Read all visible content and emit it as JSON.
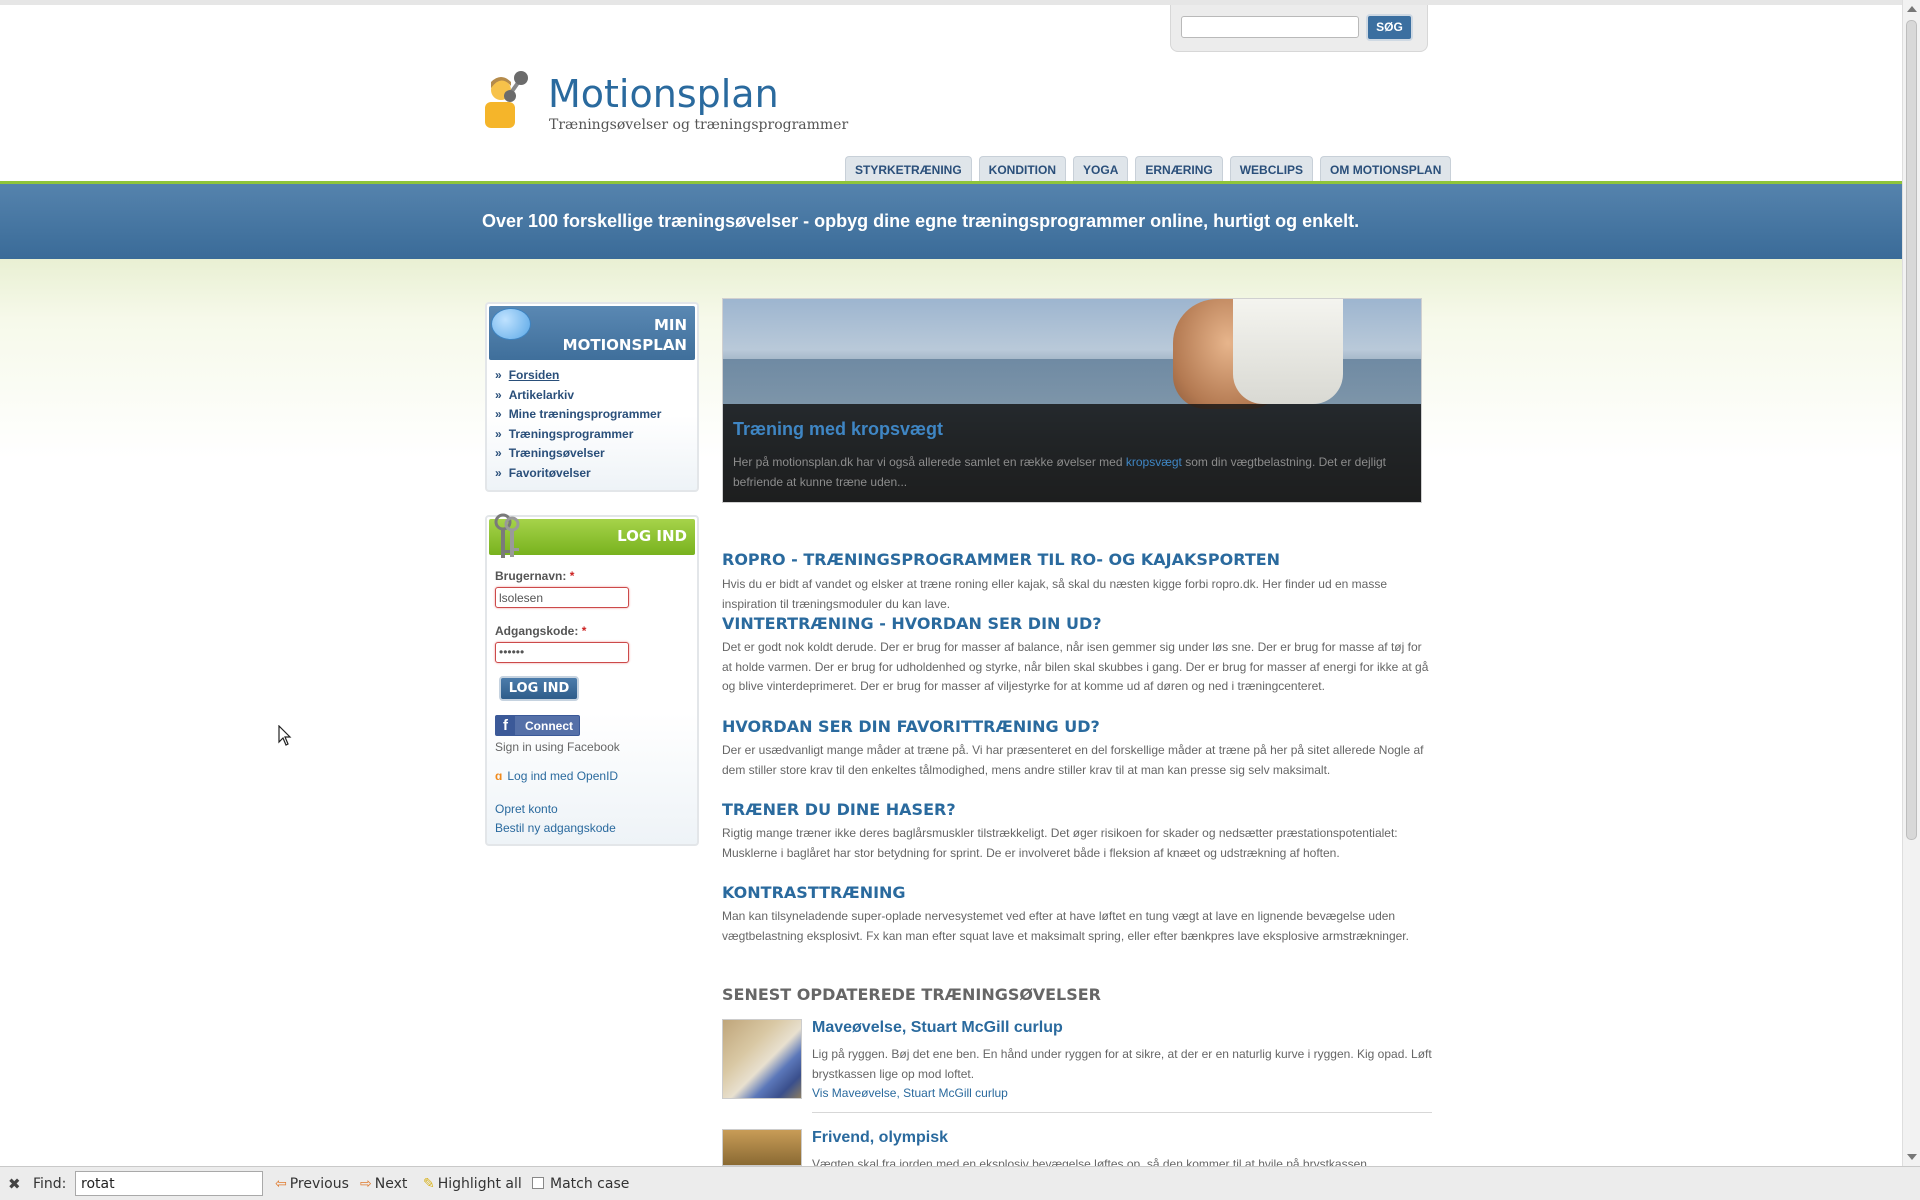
{
  "search": {
    "placeholder": "",
    "button": "SØG"
  },
  "site": {
    "title": "Motionsplan",
    "tagline": "Træningsøvelser og træningsprogrammer",
    "logo_icon": "user-dumbbell-icon"
  },
  "nav": [
    {
      "label": "STYRKETRÆNING"
    },
    {
      "label": "KONDITION"
    },
    {
      "label": "YOGA"
    },
    {
      "label": "ERNÆRING"
    },
    {
      "label": "WEBCLIPS"
    },
    {
      "label": "OM MOTIONSPLAN"
    }
  ],
  "banner": {
    "text": "Over 100 forskellige træningsøvelser - opbyg dine egne træningsprogrammer online, hurtigt og enkelt."
  },
  "menu": {
    "title_line1": "MIN",
    "title_line2": "MOTIONSPLAN",
    "items": [
      {
        "label": "Forsiden"
      },
      {
        "label": "Artikelarkiv"
      },
      {
        "label": "Mine træningsprogrammer"
      },
      {
        "label": "Træningsprogrammer"
      },
      {
        "label": "Træningsøvelser"
      },
      {
        "label": "Favoritøvelser"
      }
    ]
  },
  "login": {
    "title": "LOG IND",
    "username_label": "Brugernavn:",
    "username_value": "lsolesen",
    "password_label": "Adgangskode:",
    "password_value": "••••••",
    "required_mark": "*",
    "button": "LOG IND",
    "fb_connect": "Connect",
    "fb_sub": "Sign in using Facebook",
    "openid": "Log ind med OpenID",
    "create_account": "Opret konto",
    "reset_password": "Bestil ny adgangskode"
  },
  "hero": {
    "title": "Træning med kropsvægt",
    "text_before": "Her på motionsplan.dk har vi også allerede samlet en række øvelser med ",
    "text_link": "kropsvægt",
    "text_after": " som din vægtbelastning. Det er dejligt befriende at kunne træne uden..."
  },
  "articles": [
    {
      "title": "ROPRO - TRÆNINGSPROGRAMMER TIL RO- OG KAJAKSPORTEN",
      "body": "Hvis du er bidt af vandet og elsker at træne roning eller kajak, så skal du næsten kigge forbi ropro.dk. Her finder ud en masse inspiration til træningsmoduler du kan lave."
    },
    {
      "title": "VINTERTRÆNING - HVORDAN SER DIN UD?",
      "body": "Det er godt nok koldt derude. Der er brug for masser af balance, når isen gemmer sig under løs sne. Der er brug for masse af tøj for at holde varmen. Der er brug for udholdenhed og styrke, når bilen skal skubbes i gang. Der er brug for masser af energi for ikke at gå og blive vinterdeprimeret. Der er brug for masser af viljestyrke for at komme ud af døren og ned i træningcenteret."
    },
    {
      "title": "HVORDAN SER DIN FAVORITTRÆNING UD?",
      "body": "Der er usædvanligt mange måder at træne på. Vi har præsenteret en del forskellige måder at træne på her på sitet allerede Nogle af dem stiller store krav til den enkeltes tålmodighed, mens andre stiller krav til at man kan presse sig selv maksimalt."
    },
    {
      "title": "TRÆNER DU DINE HASER?",
      "body": "Rigtig mange træner ikke deres baglårsmuskler tilstrækkeligt. Det øger risikoen for skader og nedsætter præstationspotentialet: Musklerne i baglåret har stor betydning for sprint. De er involveret både i fleksion af knæet og udstrækning af hoften."
    },
    {
      "title": "KONTRASTTRÆNING",
      "body": "Man kan tilsyneladende super-oplade nervesystemet ved efter at have løftet en tung vægt at lave en lignende bevægelse uden vægtbelastning eksplosivt. Fx kan man efter squat lave et maksimalt spring, eller efter bænkpres lave eksplosive armstrækninger."
    }
  ],
  "recent": {
    "title": "SENEST OPDATEREDE TRÆNINGSØVELSER",
    "items": [
      {
        "title": "Maveøvelse, Stuart McGill curlup",
        "body": "Lig på ryggen. Bøj det ene ben. En hånd under ryggen for at sikre, at der er en naturlig kurve i ryggen. Kig opad. Løft brystkassen lige op mod loftet.",
        "link": "Vis Maveøvelse, Stuart McGill curlup"
      },
      {
        "title": "Frivend, olympisk",
        "body": "Vægten skal fra jorden med en eksplosiv bevægelse løftes op, så den kommer til at hvile på brystkassen"
      }
    ]
  },
  "findbar": {
    "label": "Find:",
    "value": "rotat",
    "previous": "Previous",
    "next": "Next",
    "highlight": "Highlight all",
    "match_case": "Match case"
  },
  "colors": {
    "accent": "#2a6a9e",
    "banner": "#4a79a6",
    "login_head": "#8cc232"
  }
}
